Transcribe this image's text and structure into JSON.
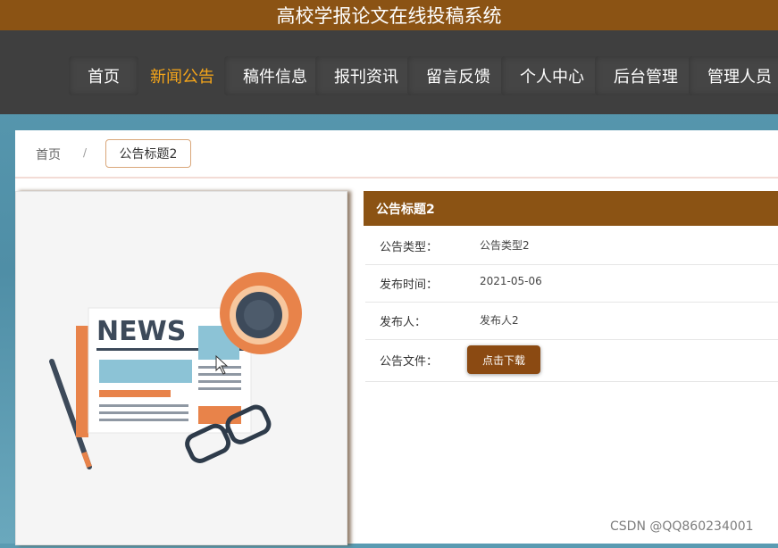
{
  "header": {
    "title": "高校学报论文在线投稿系统"
  },
  "nav": {
    "items": [
      {
        "label": "首页"
      },
      {
        "label": "新闻公告"
      },
      {
        "label": "稿件信息"
      },
      {
        "label": "报刊资讯"
      },
      {
        "label": "留言反馈"
      },
      {
        "label": "个人中心"
      },
      {
        "label": "后台管理"
      },
      {
        "label": "管理人员"
      }
    ],
    "active_index": 1,
    "active_color": "#f6a61a"
  },
  "breadcrumb": {
    "home": "首页",
    "separator": "/",
    "current": "公告标题2"
  },
  "image": {
    "news_text": "NEWS"
  },
  "detail": {
    "title": "公告标题2",
    "rows": [
      {
        "label": "公告类型：",
        "value": "公告类型2"
      },
      {
        "label": "发布时间：",
        "value": "2021-05-06"
      },
      {
        "label": "发布人：",
        "value": "发布人2"
      },
      {
        "label": "公告文件：",
        "button": "点击下载"
      }
    ]
  },
  "watermark": "CSDN @QQ860234001",
  "colors": {
    "brand": "#8b5314",
    "nav_bg": "#3f3f3f",
    "accent": "#f6a61a"
  }
}
